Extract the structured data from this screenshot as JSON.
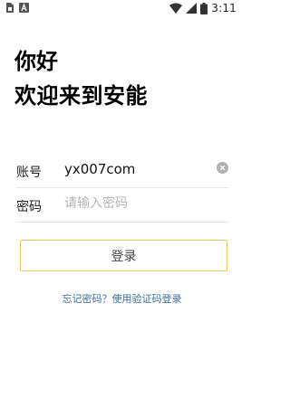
{
  "status_bar": {
    "time": "3:11",
    "left_icons": [
      "sim-card-icon",
      "keyboard-a-icon"
    ],
    "right_icons": [
      "wifi-icon",
      "signal-icon",
      "battery-icon"
    ]
  },
  "header": {
    "greeting": "你好",
    "welcome": "欢迎来到安能"
  },
  "form": {
    "account_label": "账号",
    "account_value": "yx007com",
    "password_label": "密码",
    "password_placeholder": "请输入密码"
  },
  "login_button_label": "登录",
  "alt_login_link": "忘记密码？使用验证码登录",
  "colors": {
    "button_border": "#e8c766",
    "link": "#3a6ea5",
    "placeholder": "#b5b5b5",
    "divider": "#e6e6e6"
  }
}
